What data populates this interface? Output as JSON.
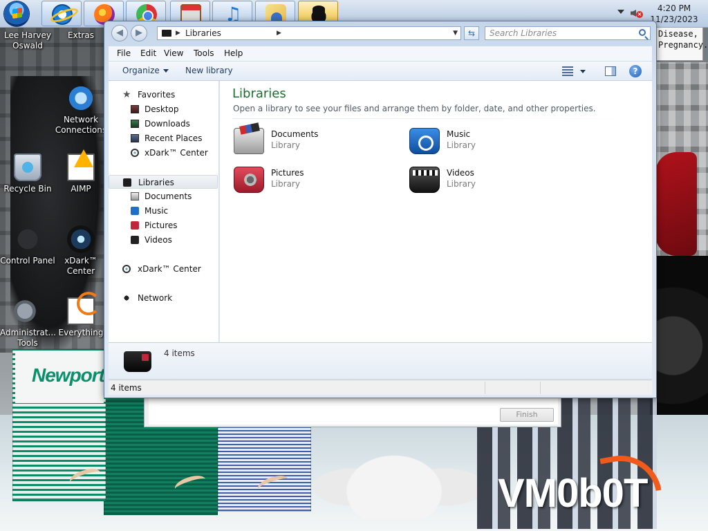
{
  "taskbar": {
    "apps": [
      {
        "name": "Internet Explorer",
        "icon": "ie-icon"
      },
      {
        "name": "Firefox",
        "icon": "firefox-icon"
      },
      {
        "name": "Chrome",
        "icon": "chrome-icon"
      },
      {
        "name": "Store",
        "icon": "store-icon"
      },
      {
        "name": "Music",
        "icon": "music-note-icon"
      },
      {
        "name": "User",
        "icon": "user-icon"
      },
      {
        "name": "xDark",
        "icon": "xdark-icon"
      }
    ],
    "clock": {
      "time": "4:20 PM",
      "date": "11/23/2023"
    }
  },
  "desktop": {
    "icons": {
      "lee": {
        "label": "Lee Harvey Oswald"
      },
      "extras": {
        "label": "Extras"
      },
      "network": {
        "label": "Network Connections"
      },
      "recycle": {
        "label": "Recycle Bin"
      },
      "aimp": {
        "label": "AIMP"
      },
      "control": {
        "label": "Control Panel"
      },
      "xdark": {
        "label": "xDark™ Center"
      },
      "admin": {
        "label": "Administrat... Tools"
      },
      "everything": {
        "label": "Everything"
      }
    },
    "poster_text": "Disease,\nPregnancy.",
    "pack_brand": "Newport",
    "watermark": "VM0b0T"
  },
  "explorer": {
    "address": {
      "path": "Libraries"
    },
    "search": {
      "placeholder": "Search Libraries"
    },
    "menu": {
      "file": "File",
      "edit": "Edit",
      "view": "View",
      "tools": "Tools",
      "help": "Help"
    },
    "toolbar": {
      "organize": "Organize",
      "new_library": "New library"
    },
    "nav": {
      "favorites": "Favorites",
      "desktop": "Desktop",
      "downloads": "Downloads",
      "recent_places": "Recent Places",
      "xdark_center": "xDark™ Center",
      "libraries": "Libraries",
      "documents": "Documents",
      "music": "Music",
      "pictures": "Pictures",
      "videos": "Videos",
      "xdark_center_2": "xDark™ Center",
      "network": "Network"
    },
    "content": {
      "title": "Libraries",
      "subtitle": "Open a library to see your files and arrange them by folder, date, and other properties.",
      "libraries": {
        "documents": {
          "name": "Documents",
          "type": "Library"
        },
        "music": {
          "name": "Music",
          "type": "Library"
        },
        "pictures": {
          "name": "Pictures",
          "type": "Library"
        },
        "videos": {
          "name": "Videos",
          "type": "Library"
        }
      }
    },
    "details": {
      "count": "4 items"
    },
    "status": {
      "count": "4 items"
    }
  },
  "dialog": {
    "finish_label": "Finish"
  },
  "colors": {
    "accent_title": "#1e6b30",
    "taskbar": "#c8d7ea"
  }
}
